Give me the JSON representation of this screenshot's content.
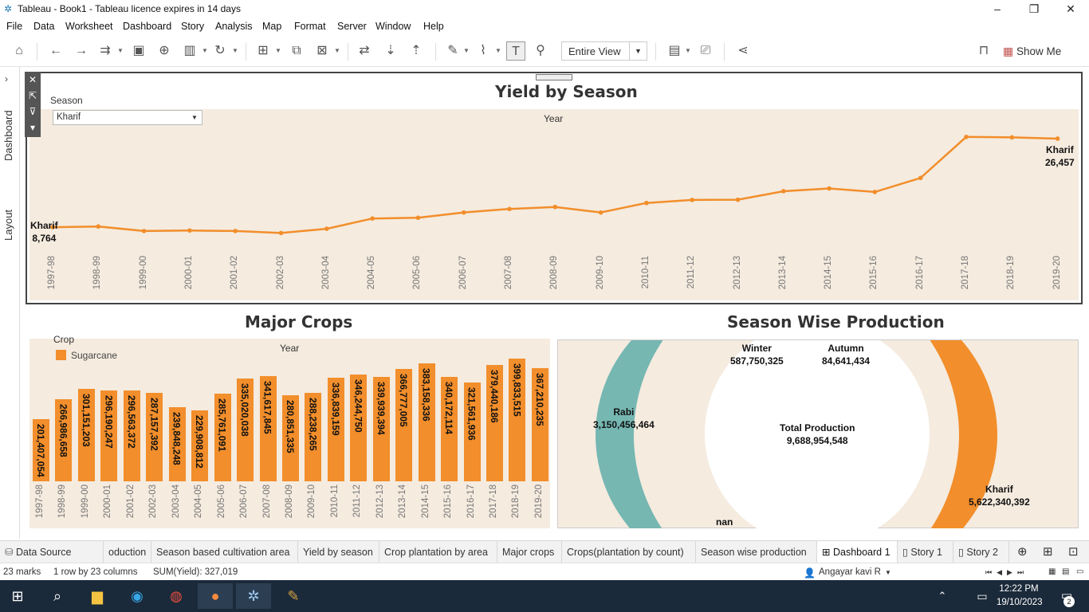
{
  "window": {
    "title": "Tableau - Book1 - Tableau licence expires in 14 days",
    "minimize": "–",
    "restore": "❐",
    "close": "✕"
  },
  "menu": [
    "File",
    "Data",
    "Worksheet",
    "Dashboard",
    "Story",
    "Analysis",
    "Map",
    "Format",
    "Server",
    "Window",
    "Help"
  ],
  "toolbar": {
    "view_select": "Entire View",
    "show_me": "Show Me"
  },
  "side_tabs": {
    "dashboard": "Dashboard",
    "layout": "Layout"
  },
  "yield_chart": {
    "title": "Yield by Season",
    "filter_label": "Season",
    "filter_value": "Kharif",
    "axis_header": "Year",
    "start_label": "Kharif",
    "start_value": "8,764",
    "end_label": "Kharif",
    "end_value": "26,457"
  },
  "crops_chart": {
    "title": "Major Crops",
    "legend_title": "Crop",
    "legend_item": "Sugarcane",
    "axis_header": "Year"
  },
  "season_chart": {
    "title": "Season Wise Production",
    "center_title": "Total Production",
    "center_value": "9,688,954,548",
    "labels": [
      {
        "name": "Winter",
        "value": "587,750,325"
      },
      {
        "name": "Autumn",
        "value": "84,641,434"
      },
      {
        "name": "Rabi",
        "value": "3,150,456,464"
      },
      {
        "name": "Kharif",
        "value": "5,622,340,392"
      },
      {
        "name": "nan",
        "value": ""
      }
    ]
  },
  "chart_data": [
    {
      "type": "line",
      "title": "Yield by Season",
      "xlabel": "Year",
      "x": [
        "1997-98",
        "1998-99",
        "1999-00",
        "2000-01",
        "2001-02",
        "2002-03",
        "2003-04",
        "2004-05",
        "2005-06",
        "2006-07",
        "2007-08",
        "2008-09",
        "2009-10",
        "2010-11",
        "2011-12",
        "2012-13",
        "2013-14",
        "2014-15",
        "2015-16",
        "2016-17",
        "2017-18",
        "2018-19",
        "2019-20"
      ],
      "series": [
        {
          "name": "Kharif",
          "values": [
            8764,
            8900,
            8000,
            8100,
            8000,
            7600,
            8450,
            10500,
            10650,
            11700,
            12400,
            12800,
            11700,
            13600,
            14200,
            14250,
            15950,
            16500,
            15800,
            18600,
            26800,
            26700,
            26457
          ]
        }
      ],
      "ylim": [
        4000,
        29000
      ],
      "color": "#f28e2b"
    },
    {
      "type": "bar",
      "title": "Major Crops",
      "xlabel": "Year",
      "categories": [
        "1997-98",
        "1998-99",
        "1999-00",
        "2000-01",
        "2001-02",
        "2002-03",
        "2003-04",
        "2004-05",
        "2005-06",
        "2006-07",
        "2007-08",
        "2008-09",
        "2009-10",
        "2010-11",
        "2011-12",
        "2012-13",
        "2013-14",
        "2014-15",
        "2015-16",
        "2016-17",
        "2017-18",
        "2018-19",
        "2019-20"
      ],
      "series": [
        {
          "name": "Sugarcane",
          "values": [
            201407054,
            266986658,
            301151203,
            296190247,
            296563372,
            287157392,
            239848248,
            229908812,
            285761091,
            335020038,
            341617845,
            280851335,
            288238265,
            336839159,
            346244750,
            339939394,
            366777005,
            383158336,
            340172114,
            321561936,
            379440186,
            399833515,
            367210235
          ]
        }
      ],
      "labels": [
        "201,407,054",
        "266,986,658",
        "301,151,203",
        "296,190,247",
        "296,563,372",
        "287,157,392",
        "239,848,248",
        "229,908,812",
        "285,761,091",
        "335,020,038",
        "341,617,845",
        "280,851,335",
        "288,238,265",
        "336,839,159",
        "346,244,750",
        "339,939,394",
        "366,777,005",
        "383,158,336",
        "340,172,114",
        "321,561,936",
        "379,440,186",
        "399,833,515",
        "367,210,235"
      ],
      "ylim": [
        0,
        420000000
      ],
      "color": "#f28e2b"
    },
    {
      "type": "pie",
      "title": "Season Wise Production",
      "categories": [
        "Kharif",
        "Rabi",
        "Winter",
        "Autumn",
        "nan"
      ],
      "values": [
        5622340392,
        3150456464,
        587750325,
        84641434,
        0
      ],
      "colors": {
        "Kharif": "#f28e2b",
        "Rabi": "#76b7b2"
      }
    }
  ],
  "sheet_tabs": [
    "Data Source",
    "oduction",
    "Season based cultivation area",
    "Yield by season",
    "Crop plantation by area",
    "Major crops",
    "Crops(plantation by count)",
    "Season wise production",
    "Dashboard 1",
    "Story 1",
    "Story 2"
  ],
  "status": {
    "marks": "23 marks",
    "dims": "1 row  by  23 columns",
    "sum": "SUM(Yield): 327,019",
    "user": "Angayar kavi R"
  },
  "taskbar": {
    "time": "12:22 PM",
    "date": "19/10/2023",
    "notif": "2"
  }
}
